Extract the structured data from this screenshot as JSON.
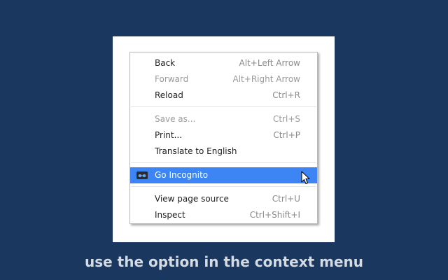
{
  "context_menu": {
    "items": [
      {
        "label": "Back",
        "shortcut": "Alt+Left Arrow",
        "enabled": true
      },
      {
        "label": "Forward",
        "shortcut": "Alt+Right Arrow",
        "enabled": false
      },
      {
        "label": "Reload",
        "shortcut": "Ctrl+R",
        "enabled": true
      },
      {
        "label": "Save as...",
        "shortcut": "Ctrl+S",
        "enabled": false
      },
      {
        "label": "Print...",
        "shortcut": "Ctrl+P",
        "enabled": true
      },
      {
        "label": "Translate to English",
        "shortcut": "",
        "enabled": true
      },
      {
        "label": "Go Incognito",
        "shortcut": "",
        "enabled": true,
        "highlighted": true,
        "icon": "incognito-icon"
      },
      {
        "label": "View page source",
        "shortcut": "Ctrl+U",
        "enabled": true
      },
      {
        "label": "Inspect",
        "shortcut": "Ctrl+Shift+I",
        "enabled": true
      }
    ]
  },
  "caption": "use the option in the context menu",
  "colors": {
    "background": "#19375f",
    "highlight": "#3d84f5",
    "caption": "#d4dbe5"
  }
}
